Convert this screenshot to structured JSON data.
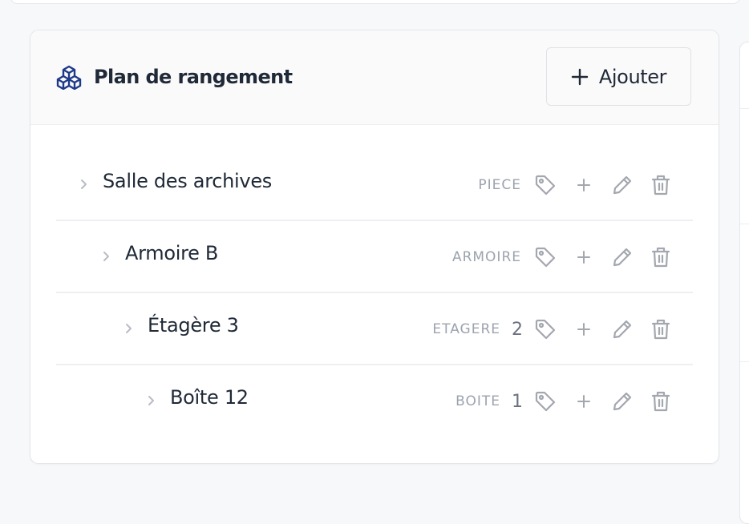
{
  "panel": {
    "title": "Plan de rangement",
    "title_icon": "cubes-icon",
    "add_button_label": "Ajouter"
  },
  "tree": {
    "items": [
      {
        "name": "Salle des archives",
        "type": "PIECE",
        "count": ""
      },
      {
        "name": "Armoire B",
        "type": "ARMOIRE",
        "count": ""
      },
      {
        "name": "Étagère 3",
        "type": "ETAGERE",
        "count": "2"
      },
      {
        "name": "Boîte 12",
        "type": "BOITE",
        "count": "1"
      }
    ],
    "row_icons": [
      "chevron-right-icon",
      "tag-icon",
      "plus-icon",
      "pencil-icon",
      "trash-icon"
    ]
  },
  "colors": {
    "accent": "#1e3a8a",
    "text": "#1f2937",
    "muted": "#9ca3af",
    "border": "#e4e6ea",
    "header_bg": "#fafafa"
  }
}
